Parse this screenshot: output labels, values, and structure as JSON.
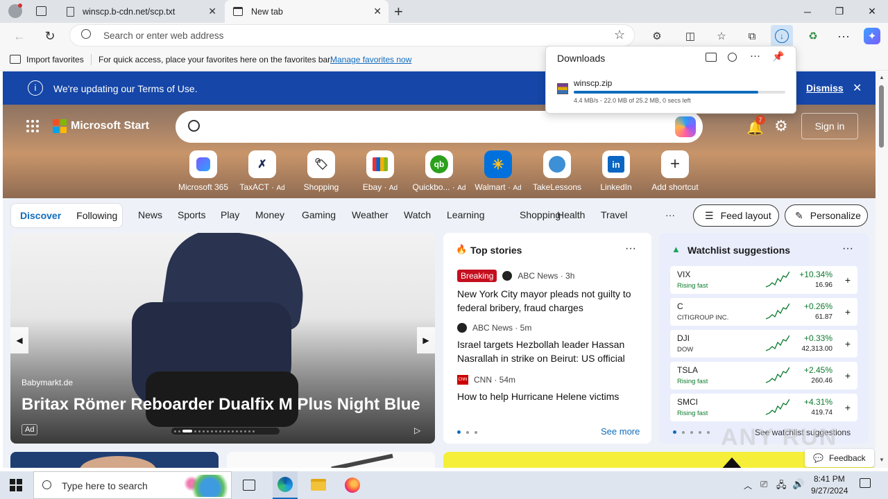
{
  "browser": {
    "tabs": [
      {
        "label": "winscp.b-cdn.net/scp.txt"
      },
      {
        "label": "New tab"
      }
    ],
    "address_placeholder": "Search or enter web address",
    "favorites_bar": {
      "import_label": "Import favorites",
      "message": "For quick access, place your favorites here on the favorites bar.",
      "manage_link": "Manage favorites now"
    }
  },
  "downloads": {
    "title": "Downloads",
    "item": {
      "filename": "winscp.zip",
      "status": "4.4 MB/s - 22.0 MB of 25.2 MB, 0 secs left",
      "progress": 0.873
    }
  },
  "page": {
    "terms_banner": {
      "text": "We're updating our Terms of Use.",
      "dismiss": "Dismiss"
    },
    "brand": "Microsoft Start",
    "notification_count": "7",
    "sign_in": "Sign in",
    "shortcuts": [
      {
        "label": "Microsoft 365",
        "ad": "",
        "icon": "m365-icon"
      },
      {
        "label": "TaxACT",
        "ad": "Ad",
        "icon": "taxact-icon"
      },
      {
        "label": "Shopping",
        "ad": "",
        "icon": "shopping-tag-icon"
      },
      {
        "label": "Ebay",
        "ad": "Ad",
        "icon": "ebay-bag-icon"
      },
      {
        "label": "Quickbo...",
        "ad": "Ad",
        "icon": "quickbooks-icon"
      },
      {
        "label": "Walmart",
        "ad": "Ad",
        "icon": "walmart-icon"
      },
      {
        "label": "TakeLessons",
        "ad": "",
        "icon": "takelessons-icon"
      },
      {
        "label": "LinkedIn",
        "ad": "",
        "icon": "linkedin-icon"
      },
      {
        "label": "Add shortcut",
        "ad": "",
        "icon": "plus-icon"
      }
    ],
    "nav": {
      "pill": [
        "Discover",
        "Following"
      ],
      "items": [
        "News",
        "Sports",
        "Play",
        "Money",
        "Gaming",
        "Weather",
        "Watch",
        "Learning",
        "Shopping",
        "Health",
        "Travel"
      ],
      "more": "···",
      "feed_layout": "Feed layout",
      "personalize": "Personalize"
    },
    "hero_ad": {
      "source": "Babymarkt.de",
      "title": "Britax Römer Reboarder Dualfix M Plus Night Blue",
      "ad_badge": "Ad"
    },
    "top_stories": {
      "title": "Top stories",
      "stories": [
        {
          "badge": "Breaking",
          "source": "ABC News · 3h",
          "headline": "New York City mayor pleads not guilty to federal bribery, fraud charges"
        },
        {
          "badge": "",
          "source": "ABC News · 5m",
          "headline": "Israel targets Hezbollah leader Hassan Nasrallah in strike on Beirut: US official"
        },
        {
          "badge": "",
          "source": "CNN · 54m",
          "headline": "How to help Hurricane Helene victims"
        }
      ],
      "see_more": "See more"
    },
    "watchlist": {
      "title": "Watchlist suggestions",
      "rows": [
        {
          "symbol": "VIX",
          "sub": "Rising fast",
          "change": "+10.34%",
          "price": "16.96"
        },
        {
          "symbol": "C",
          "sub": "CITIGROUP INC.",
          "change": "+0.26%",
          "price": "61.87"
        },
        {
          "symbol": "DJI",
          "sub": "DOW",
          "change": "+0.33%",
          "price": "42,313.00"
        },
        {
          "symbol": "TSLA",
          "sub": "Rising fast",
          "change": "+2.45%",
          "price": "260.46"
        },
        {
          "symbol": "SMCI",
          "sub": "Rising fast",
          "change": "+4.31%",
          "price": "419.74"
        }
      ],
      "see_link": "See watchlist suggestions"
    },
    "feedback": "Feedback",
    "watermark": "ANY RUN"
  },
  "taskbar": {
    "search_placeholder": "Type here to search",
    "time": "8:41 PM",
    "date": "9/27/2024"
  },
  "colors": {
    "accent": "#0f6cbd",
    "terms_banner": "#1546a8",
    "breaking": "#c50f1f",
    "positive": "#0b7a2c"
  }
}
